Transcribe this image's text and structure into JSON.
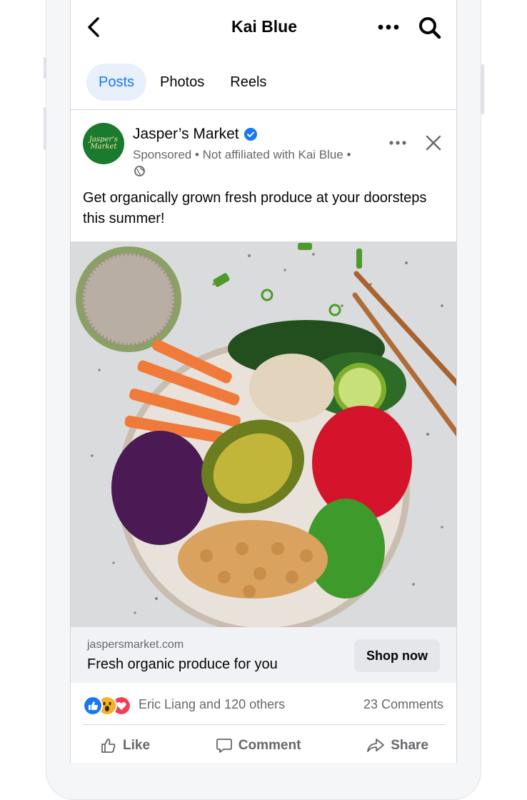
{
  "header": {
    "title": "Kai Blue"
  },
  "tabs": [
    {
      "label": "Posts",
      "active": true
    },
    {
      "label": "Photos",
      "active": false
    },
    {
      "label": "Reels",
      "active": false
    }
  ],
  "post": {
    "advertiser": "Jasper’s Market",
    "avatar_text": "Jasper's Market",
    "meta": "Sponsored • Not affiliated with Kai Blue •",
    "caption": "Get organically grown fresh produce at your doorsteps this summer!",
    "link": {
      "domain": "jaspersmarket.com",
      "headline": "Fresh organic produce for you",
      "cta": "Shop now"
    },
    "reactions_text": "Eric Liang and 120 others",
    "comments": "23 Comments",
    "actions": {
      "like": "Like",
      "comment": "Comment",
      "share": "Share"
    }
  },
  "icons": {
    "back": "chevron-left-icon",
    "more": "ellipsis-icon",
    "search": "search-icon",
    "verified": "verified-badge-icon",
    "globe": "globe-icon",
    "close": "close-icon"
  },
  "colors": {
    "accent": "#1877f2",
    "avatar_bg": "#1a7a2e",
    "like": "#1877f2",
    "love": "#f33e58",
    "wow": "#f7b125"
  }
}
